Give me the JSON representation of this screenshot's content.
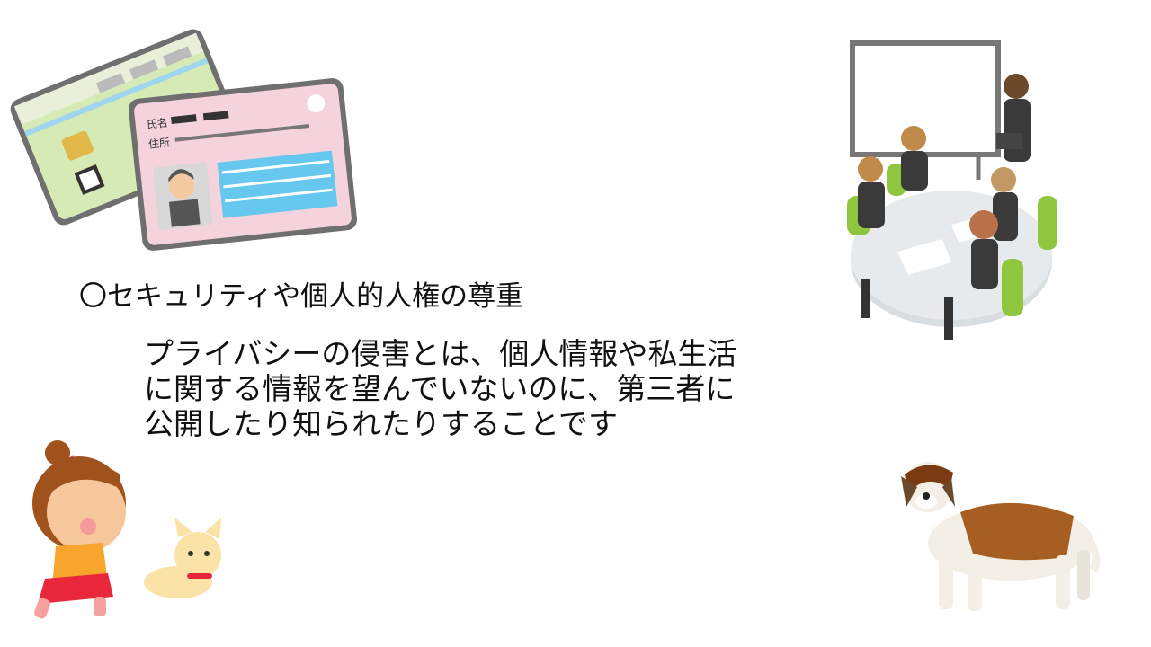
{
  "slide": {
    "heading": "〇セキュリティや個人的人権の尊重",
    "body_lines": [
      "プライバシーの侵害とは、個人情報や私生活",
      "に関する情報を望んでいないのに、第三者に",
      "公開したり知られたりすることです"
    ]
  },
  "illustrations": {
    "id_cards": {
      "name_label": "氏名",
      "address_label": "住所"
    }
  },
  "colors": {
    "card_back": "#d6eab5",
    "card_front": "#f5d3dc",
    "chair_green": "#8ec63f",
    "dog_brown": "#a65e22"
  }
}
